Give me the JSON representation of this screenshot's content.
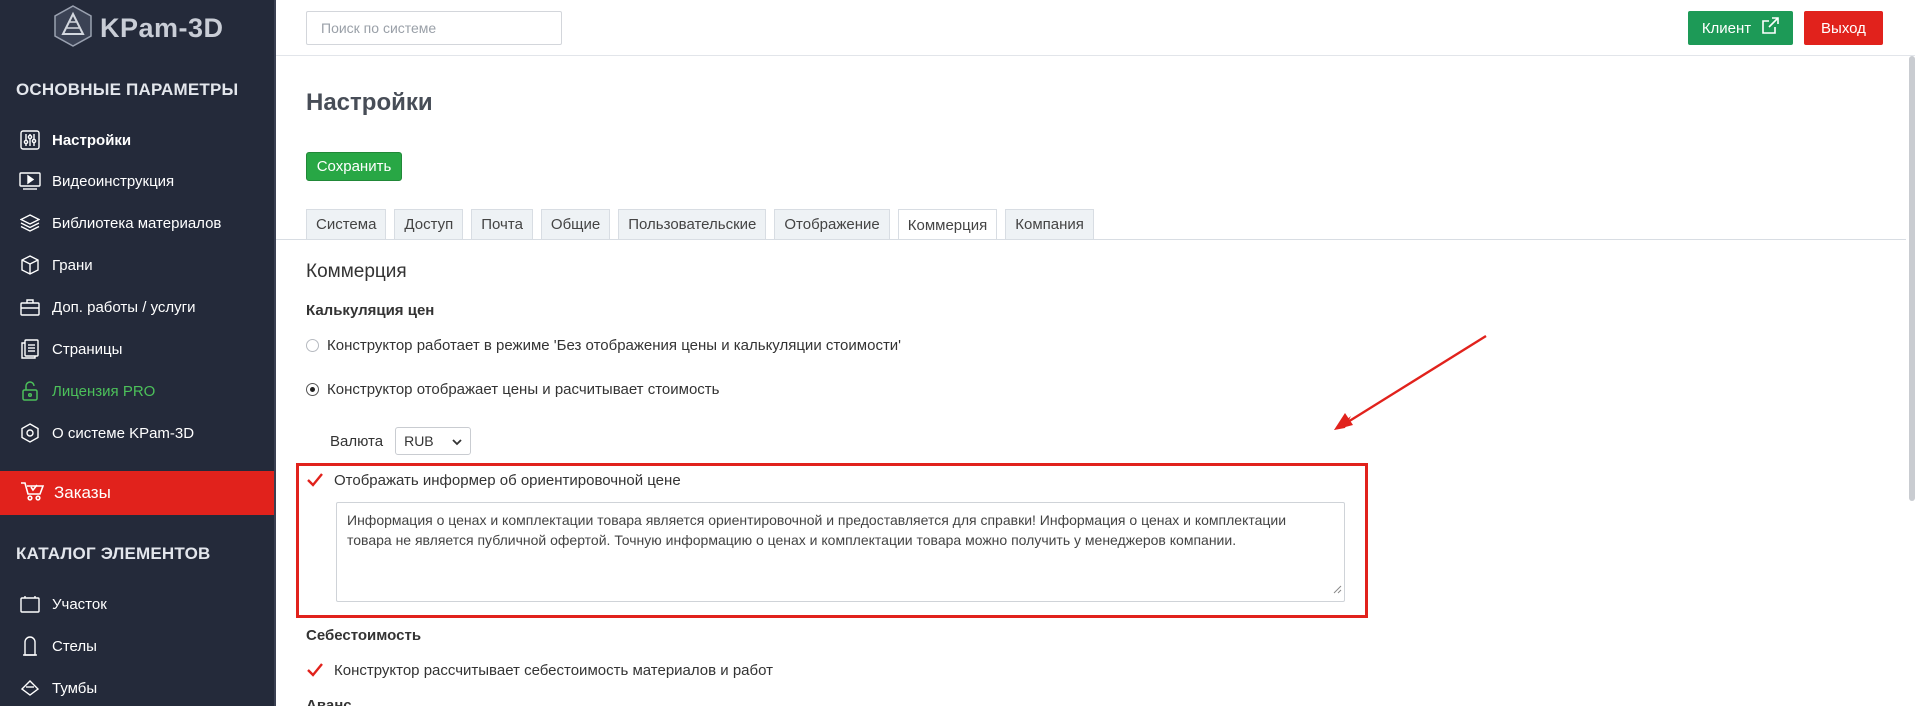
{
  "app": {
    "logo_text": "KPam-3D"
  },
  "sidebar": {
    "section_main": "ОСНОВНЫЕ ПАРАМЕТРЫ",
    "main_items": [
      {
        "label": "Настройки",
        "icon": "sliders-icon",
        "active": true
      },
      {
        "label": "Видеоинструкция",
        "icon": "video-icon"
      },
      {
        "label": "Библиотека материалов",
        "icon": "layers-icon"
      },
      {
        "label": "Грани",
        "icon": "cube-icon"
      },
      {
        "label": "Доп. работы / услуги",
        "icon": "briefcase-icon"
      },
      {
        "label": "Страницы",
        "icon": "pages-icon"
      },
      {
        "label": "Лицензия PRO",
        "icon": "lock-icon",
        "color": "#4cc05a"
      },
      {
        "label": "О системе KPam-3D",
        "icon": "info-icon"
      }
    ],
    "orders_label": "Заказы",
    "section_catalog": "КАТАЛОГ ЭЛЕМЕНТОВ",
    "catalog_items": [
      {
        "label": "Участок",
        "icon": "plot-icon"
      },
      {
        "label": "Стелы",
        "icon": "stele-icon"
      },
      {
        "label": "Тумбы",
        "icon": "pedestal-icon"
      }
    ]
  },
  "topbar": {
    "search_placeholder": "Поиск по системе",
    "client_label": "Клиент",
    "exit_label": "Выход"
  },
  "colors": {
    "sidebar_bg": "#242a3a",
    "accent_red": "#e1221c",
    "accent_green": "#1d9a57",
    "save_green": "#28a745"
  },
  "main": {
    "title": "Настройки",
    "save_label": "Сохранить",
    "tabs": [
      "Система",
      "Доступ",
      "Почта",
      "Общие",
      "Пользовательские",
      "Отображение",
      "Коммерция",
      "Компания"
    ],
    "active_tab": "Коммерция",
    "section_title": "Коммерция",
    "pricing": {
      "heading": "Калькуляция цен",
      "option_no_price": "Конструктор работает в режиме 'Без отображения цены и калькуляции стоимости'",
      "option_with_price": "Конструктор отображает цены и расчитывает стоимость",
      "selected": "option_with_price",
      "currency_label": "Валюта",
      "currency_value": "RUB"
    },
    "informer": {
      "label": "Отображать информер об ориентировочной цене",
      "checked": true,
      "text": "Информация о ценах и комплектации товара является ориентировочной и предоставляется для справки! Информация о ценах и комплектации товара не является публичной офертой. Точную информацию о ценах и комплектации товара можно получить у менеджеров компании."
    },
    "cost": {
      "heading": "Себестоимость",
      "label": "Конструктор рассчитывает себестоимость материалов и работ",
      "checked": true
    },
    "advance_heading": "Аванс"
  }
}
